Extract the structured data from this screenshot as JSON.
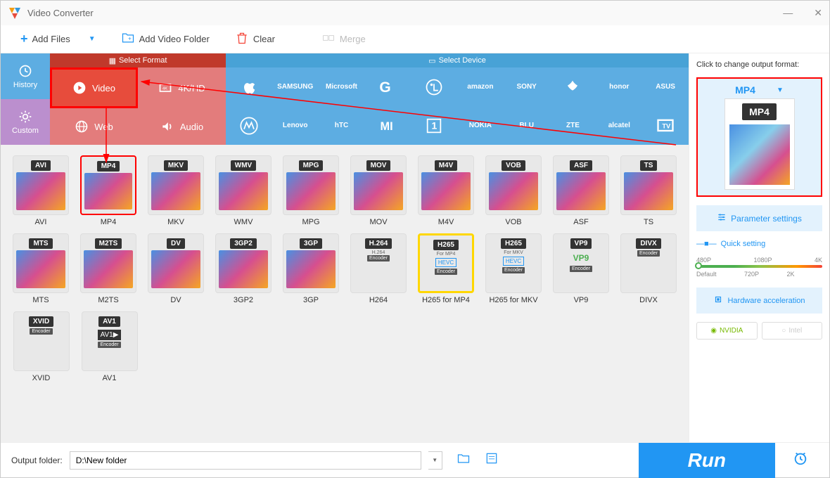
{
  "title": "Video Converter",
  "toolbar": {
    "add_files": "Add Files",
    "add_folder": "Add Video Folder",
    "clear": "Clear",
    "merge": "Merge"
  },
  "sidetabs": {
    "history": "History",
    "custom": "Custom"
  },
  "format_header": "Select Format",
  "device_header": "Select Device",
  "format_cats": {
    "video": "Video",
    "hd": "4K/HD",
    "web": "Web",
    "audio": "Audio"
  },
  "brands": [
    "Apple",
    "SAMSUNG",
    "Microsoft",
    "Google",
    "LG",
    "amazon",
    "SONY",
    "HUAWEI",
    "honor",
    "ASUS",
    "Motorola",
    "Lenovo",
    "hTC",
    "Xiaomi",
    "OnePlus",
    "NOKIA",
    "BLU",
    "ZTE",
    "alcatel",
    "TV"
  ],
  "formats_r1": [
    {
      "badge": "AVI",
      "label": "AVI"
    },
    {
      "badge": "MP4",
      "label": "MP4",
      "selected": true
    },
    {
      "badge": "MKV",
      "label": "MKV"
    },
    {
      "badge": "WMV",
      "label": "WMV"
    },
    {
      "badge": "MPG",
      "label": "MPG"
    },
    {
      "badge": "MOV",
      "label": "MOV"
    },
    {
      "badge": "M4V",
      "label": "M4V"
    },
    {
      "badge": "VOB",
      "label": "VOB"
    },
    {
      "badge": "ASF",
      "label": "ASF"
    },
    {
      "badge": "TS",
      "label": "TS"
    }
  ],
  "formats_r2": [
    {
      "badge": "MTS",
      "label": "MTS"
    },
    {
      "badge": "M2TS",
      "label": "M2TS"
    },
    {
      "badge": "DV",
      "label": "DV"
    },
    {
      "badge": "3GP2",
      "label": "3GP2"
    },
    {
      "badge": "3GP",
      "label": "3GP"
    },
    {
      "badge": "H.264",
      "label": "H264",
      "sub": "H.264",
      "enc": "Encoder"
    },
    {
      "badge": "H265",
      "label": "H265 for MP4",
      "sub": "For MP4",
      "hevc": "HEVC",
      "enc": "Encoder",
      "h265": true
    },
    {
      "badge": "H265",
      "label": "H265 for MKV",
      "sub": "For MKV",
      "hevc": "HEVC",
      "enc": "Encoder"
    },
    {
      "badge": "VP9",
      "label": "VP9",
      "vp9": "VP9",
      "enc": "Encoder"
    },
    {
      "badge": "DIVX",
      "label": "DIVX",
      "enc": "Encoder"
    }
  ],
  "formats_r3": [
    {
      "badge": "XVID",
      "label": "XVID",
      "enc": "Encoder"
    },
    {
      "badge": "AV1",
      "label": "AV1",
      "av1": "AV1",
      "enc": "Encoder"
    }
  ],
  "right": {
    "hint": "Click to change output format:",
    "format": "MP4",
    "param": "Parameter settings",
    "quick": "Quick setting",
    "ticks_top": [
      "480P",
      "1080P",
      "4K"
    ],
    "ticks_bot": [
      "Default",
      "720P",
      "2K",
      ""
    ],
    "hw": "Hardware acceleration",
    "nvidia": "NVIDIA",
    "intel": "Intel"
  },
  "bottom": {
    "label": "Output folder:",
    "path": "D:\\New folder",
    "run": "Run"
  }
}
